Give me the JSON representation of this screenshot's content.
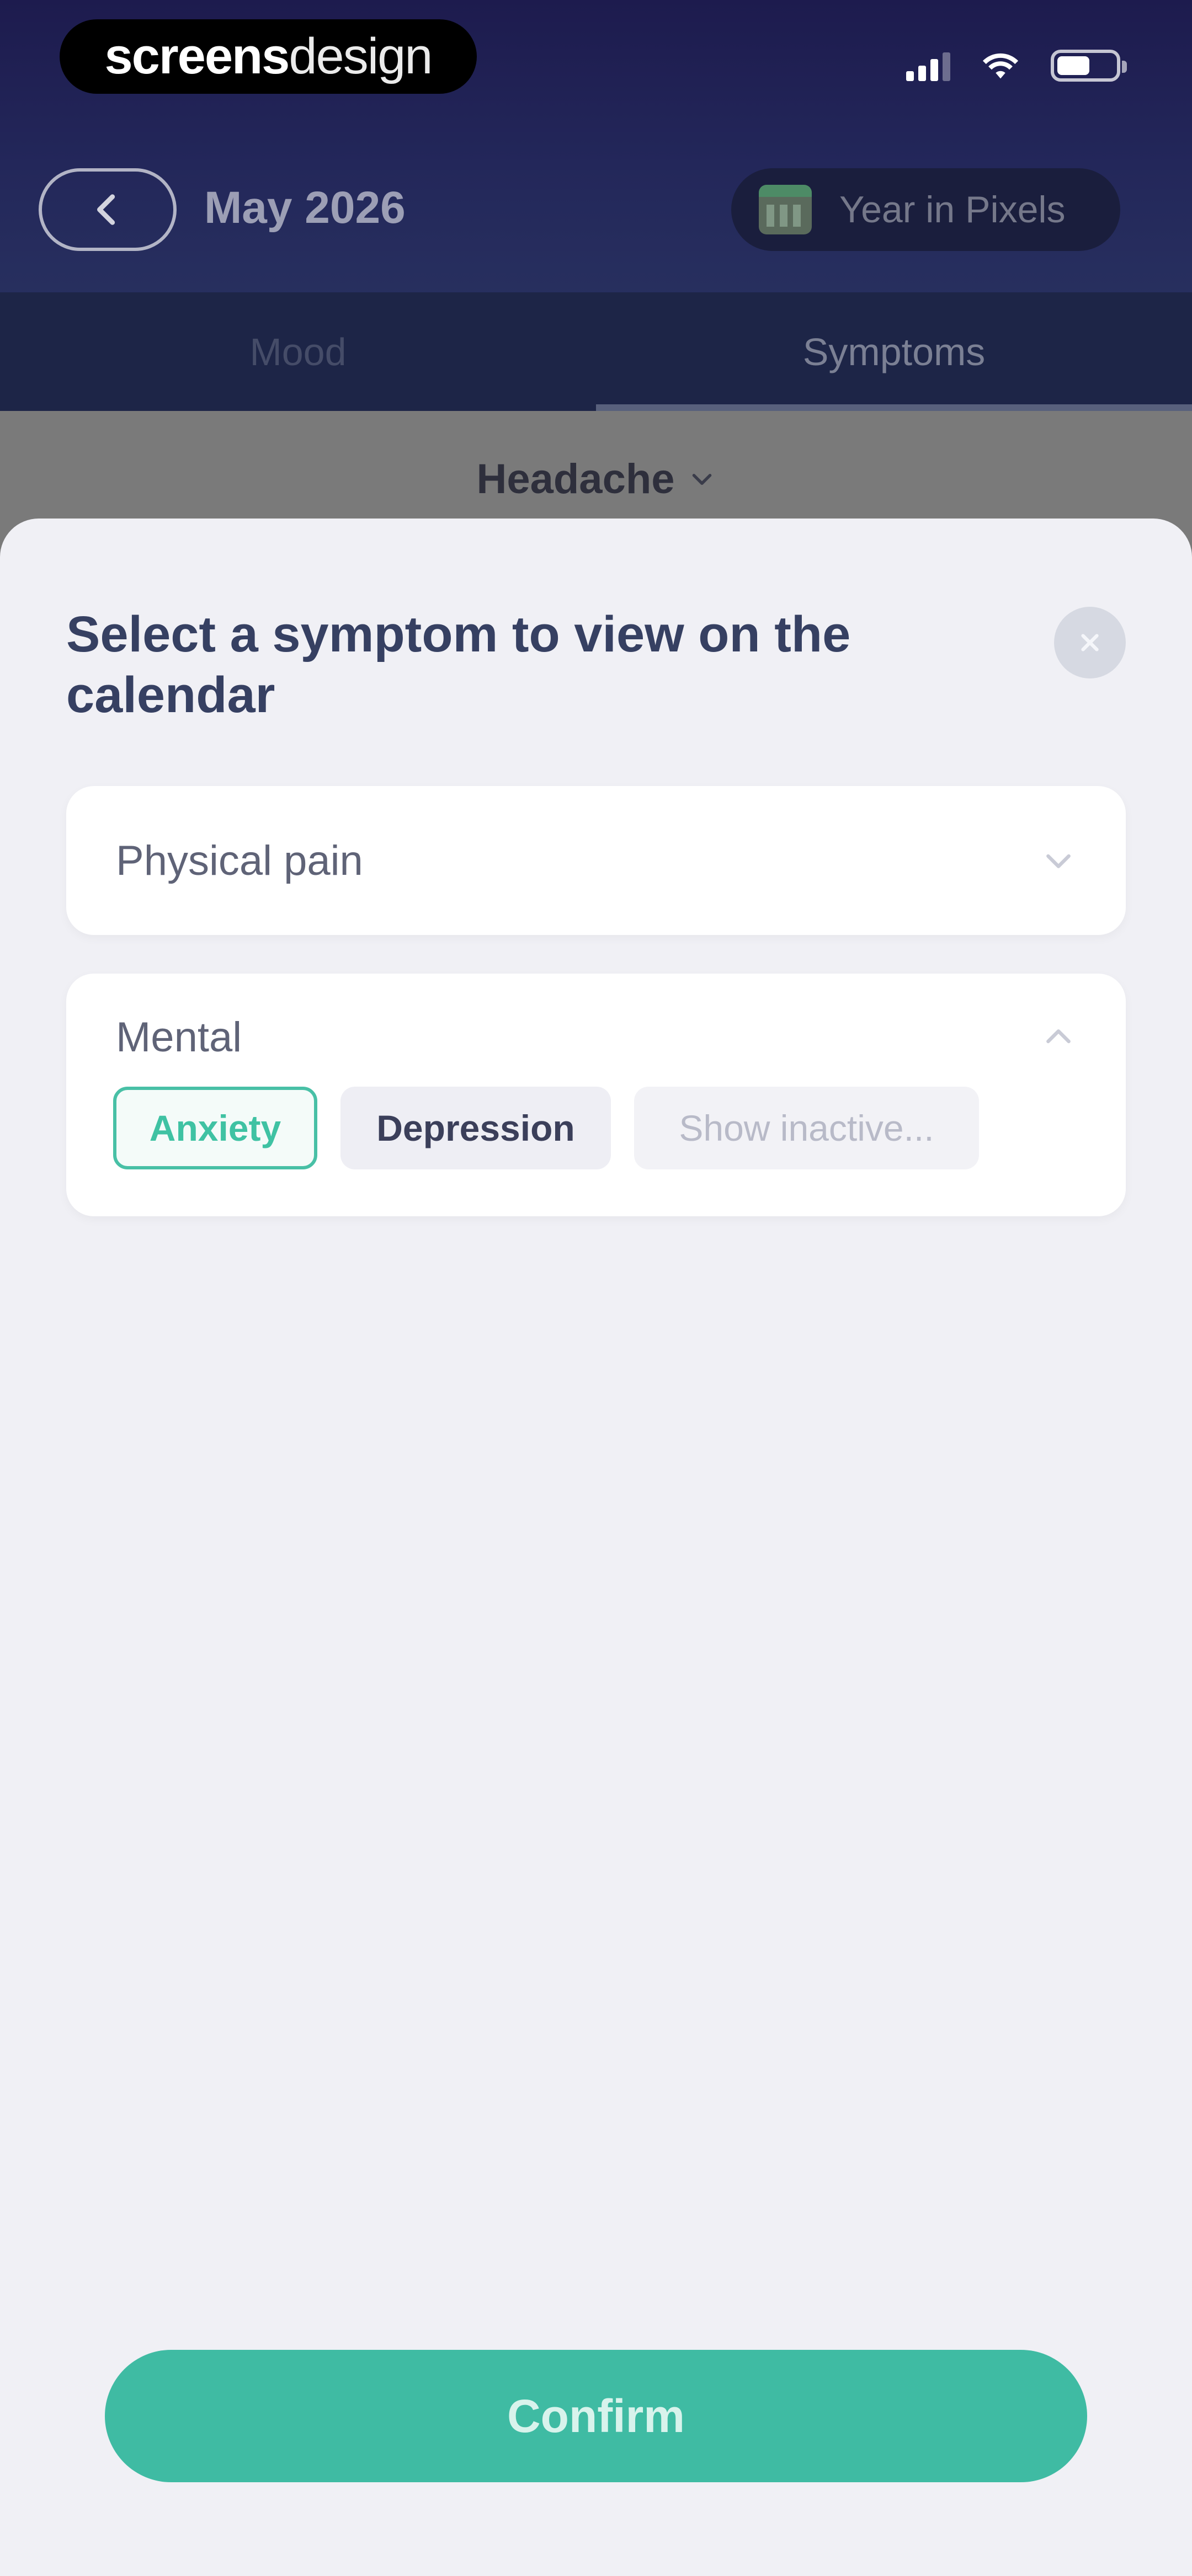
{
  "status_bar": {
    "brand_bold": "screens",
    "brand_light": "design"
  },
  "topbar": {
    "month": "May 2026",
    "year_in_pixels_label": "Year in Pixels"
  },
  "tabs": [
    {
      "label": "Mood",
      "active": false
    },
    {
      "label": "Symptoms",
      "active": true
    }
  ],
  "filter": {
    "selected_symptom": "Headache"
  },
  "sheet": {
    "title": "Select a symptom to view on the calendar",
    "groups": [
      {
        "label": "Physical pain",
        "expanded": false
      },
      {
        "label": "Mental",
        "expanded": true,
        "chips": [
          {
            "label": "Anxiety",
            "selected": true
          },
          {
            "label": "Depression",
            "selected": false
          },
          {
            "label": "Show inactive...",
            "selected": false
          }
        ]
      }
    ],
    "confirm_label": "Confirm"
  },
  "colors": {
    "accent": "#3fbba3",
    "header_bg": "#1d1b4e",
    "sheet_bg": "#f0f0f5"
  }
}
